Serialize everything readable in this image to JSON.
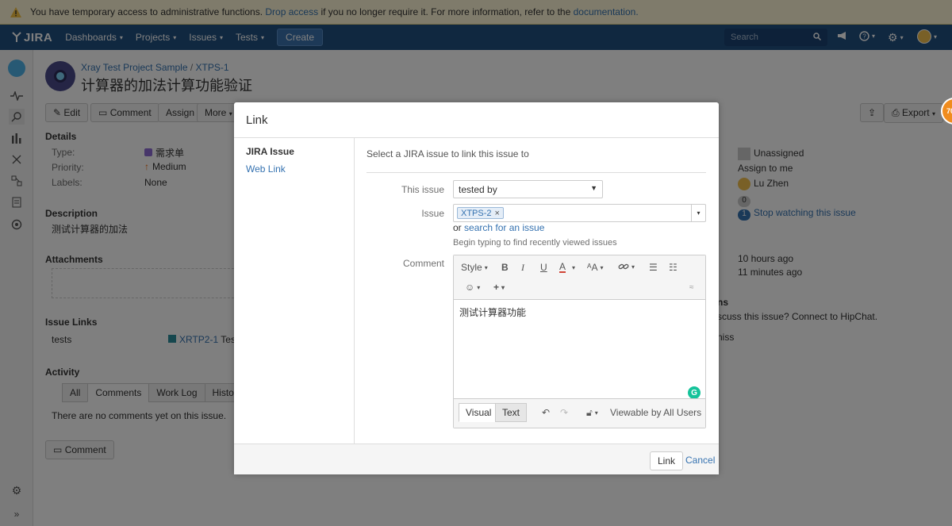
{
  "banner": {
    "text_before": "You have temporary access to administrative functions.",
    "drop_access_link": "Drop access",
    "text_middle": "if you no longer require it. For more information, refer to the",
    "documentation_link": "documentation."
  },
  "nav": {
    "logo": "JIRA",
    "items": [
      "Dashboards",
      "Projects",
      "Issues",
      "Tests"
    ],
    "create": "Create",
    "search_placeholder": "Search"
  },
  "issue": {
    "project": "Xray Test Project Sample",
    "separator": "/",
    "key": "XTPS-1",
    "title": "计算器的加法计算功能验证"
  },
  "actions": {
    "edit": "Edit",
    "comment": "Comment",
    "assign": "Assign",
    "more": "More",
    "export": "Export"
  },
  "details": {
    "heading": "Details",
    "type_label": "Type:",
    "type_value": "需求单",
    "priority_label": "Priority:",
    "priority_value": "Medium",
    "labels_label": "Labels:",
    "labels_value": "None"
  },
  "description": {
    "heading": "Description",
    "text": "测试计算器的加法"
  },
  "attachments": {
    "heading": "Attachments"
  },
  "issue_links": {
    "heading": "Issue Links",
    "relation": "tests",
    "linked_key": "XRTP2-1",
    "linked_text": "Test"
  },
  "activity": {
    "heading": "Activity",
    "tabs": [
      "All",
      "Comments",
      "Work Log",
      "History"
    ],
    "empty": "There are no comments yet on this issue.",
    "comment_button": "Comment"
  },
  "people": {
    "assignee": "Unassigned",
    "assign_to_me": "Assign to me",
    "reporter": "Lu Zhen",
    "votes": "0",
    "watchers": "1",
    "stop_watching": "Stop watching this issue"
  },
  "dates": {
    "created": "10 hours ago",
    "updated": "11 minutes ago"
  },
  "hipchat": {
    "heading_fragment": "ns",
    "text": "scuss this issue? Connect to HipChat.",
    "link_fragment": "niss"
  },
  "badge": "70",
  "dialog": {
    "title": "Link",
    "side": [
      "JIRA Issue",
      "Web Link"
    ],
    "instruction": "Select a JIRA issue to link this issue to",
    "this_issue_label": "This issue",
    "this_issue_value": "tested by",
    "issue_label": "Issue",
    "issue_chip": "XTPS-2",
    "or_text": "or",
    "search_link": "search for an issue",
    "hint": "Begin typing to find recently viewed issues",
    "comment_label": "Comment",
    "style_label": "Style",
    "editor_text": "测试计算器功能",
    "mode_visual": "Visual",
    "mode_text": "Text",
    "visibility": "Viewable by All Users",
    "link_button": "Link",
    "cancel": "Cancel"
  }
}
